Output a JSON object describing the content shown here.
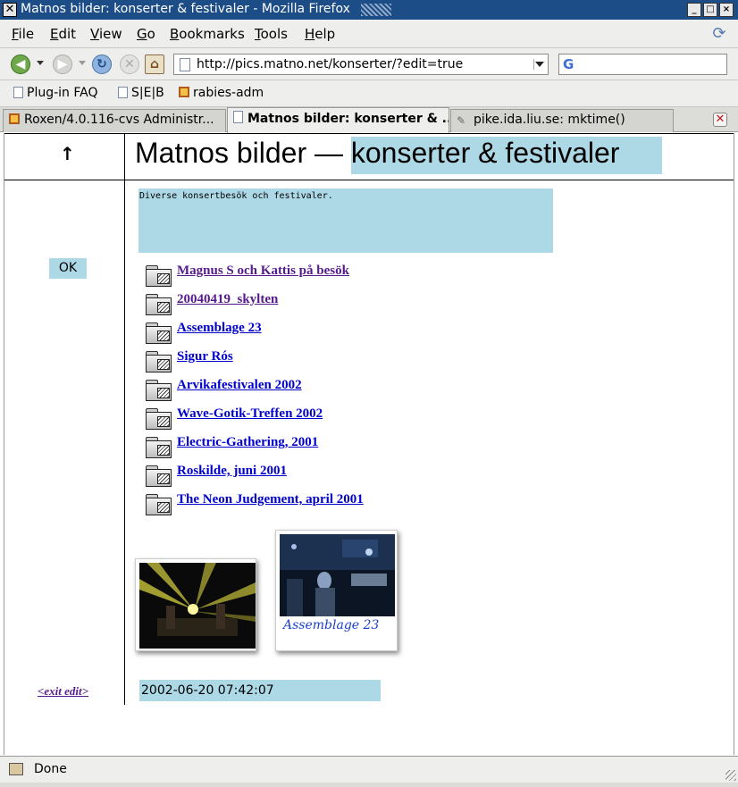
{
  "window": {
    "title": "Matnos bilder: konserter & festivaler - Mozilla Firefox"
  },
  "menu": {
    "items": [
      {
        "first": "F",
        "rest": "ile"
      },
      {
        "first": "E",
        "rest": "dit"
      },
      {
        "first": "V",
        "rest": "iew"
      },
      {
        "first": "G",
        "rest": "o"
      },
      {
        "first": "B",
        "rest": "ookmarks"
      },
      {
        "first": "T",
        "rest": "ools"
      },
      {
        "first": "H",
        "rest": "elp"
      }
    ]
  },
  "navbar": {
    "url": "http://pics.matno.net/konserter/?edit=true",
    "search_value": ""
  },
  "bookmarks": [
    {
      "label": "Plug-in FAQ",
      "icon": "page-icon"
    },
    {
      "label": "S|E|B",
      "icon": "page-icon"
    },
    {
      "label": "rabies-adm",
      "icon": "roxen-icon"
    }
  ],
  "tabs": [
    {
      "label": "Roxen/4.0.116-cvs Administr...",
      "icon": "roxen-icon",
      "active": false
    },
    {
      "label": "Matnos bilder: konserter & ...",
      "icon": "page-icon",
      "active": true
    },
    {
      "label": "pike.ida.liu.se: mktime()",
      "icon": "pike-icon",
      "active": false
    }
  ],
  "page": {
    "up_arrow": "🠕",
    "title_prefix": "Matnos bilder — ",
    "title_highlight": "konserter & festivaler",
    "description": "Diverse konsertbesök och festivaler.",
    "ok_label": "OK",
    "folders": [
      {
        "label": "Magnus S och Kattis på besök",
        "visited": true
      },
      {
        "label": "20040419_skylten",
        "visited": true
      },
      {
        "label": "Assemblage 23",
        "visited": false
      },
      {
        "label": "Sigur Rós",
        "visited": false
      },
      {
        "label": "Arvikafestivalen 2002",
        "visited": false
      },
      {
        "label": "Wave-Gotik-Treffen 2002",
        "visited": false
      },
      {
        "label": "Electric-Gathering, 2001",
        "visited": false
      },
      {
        "label": "Roskilde, juni 2001",
        "visited": false
      },
      {
        "label": "The Neon Judgement, april 2001",
        "visited": false
      }
    ],
    "thumbnail_caption": "Assemblage 23",
    "exit_edit": "<exit edit>",
    "timestamp": "2002-06-20 07:42:07"
  },
  "status": {
    "text": "Done"
  },
  "colors": {
    "highlight": "#add8e6",
    "titlebar": "#1d4d86",
    "visited_link": "#551a8b",
    "link": "#0000cc"
  }
}
